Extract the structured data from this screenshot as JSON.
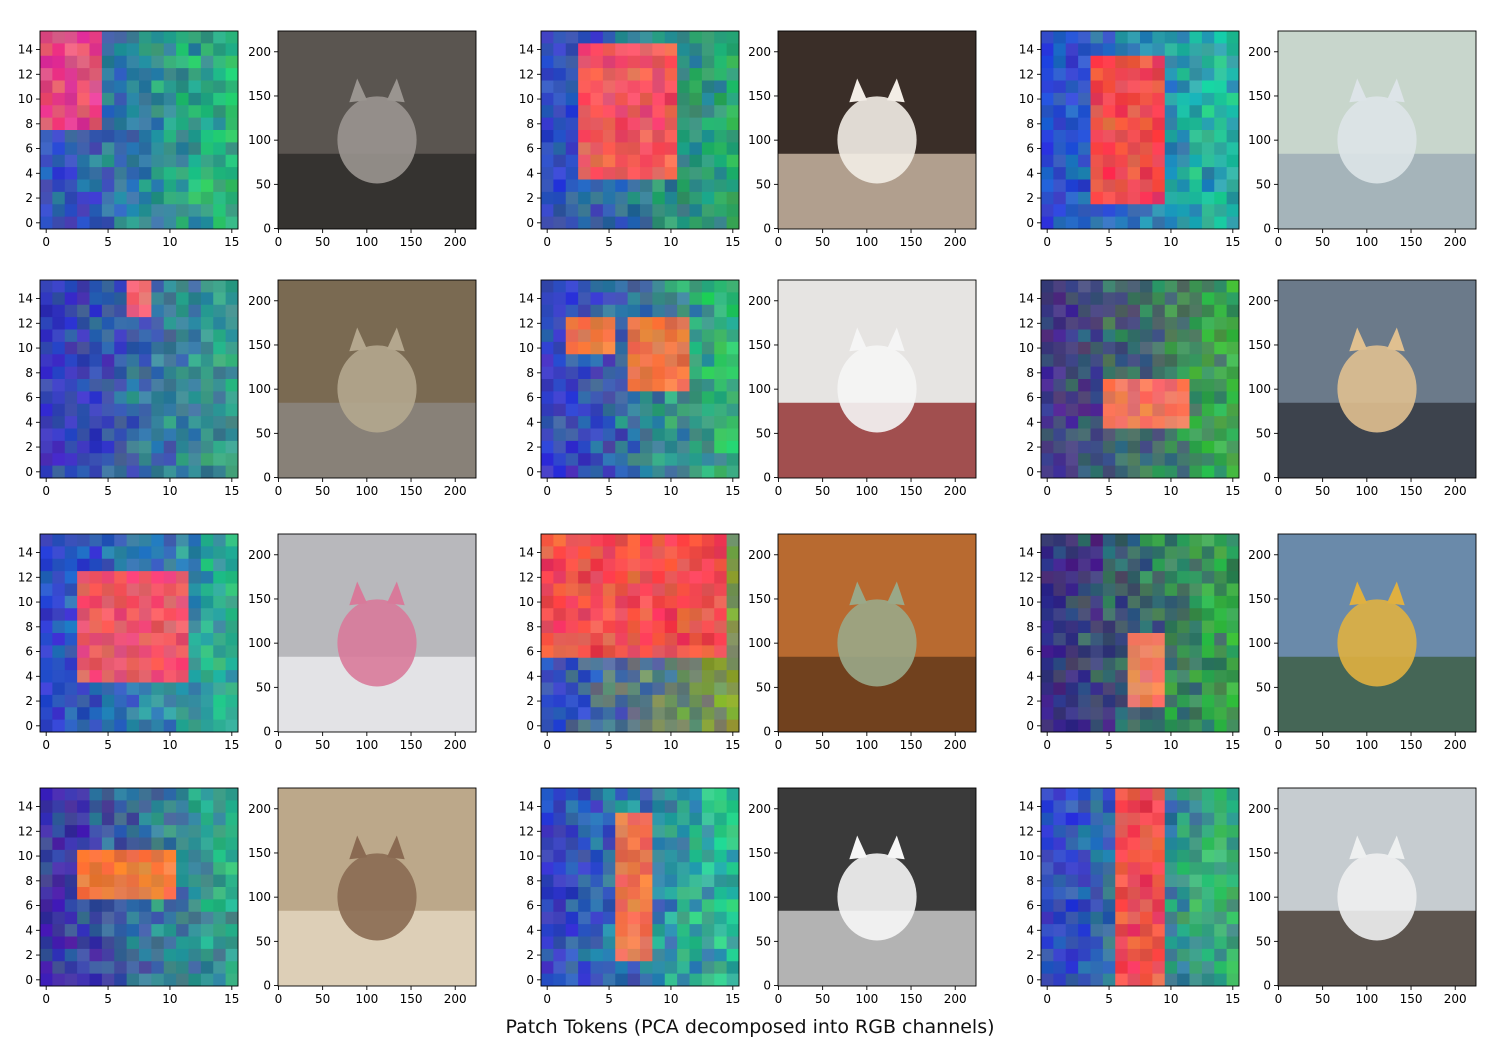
{
  "figure": {
    "caption": "Patch Tokens (PCA decomposed into RGB channels)"
  },
  "chart_data": {
    "type": "heatmap",
    "title": "",
    "xlabel": "",
    "ylabel": "",
    "grid": false,
    "layout": "4 rows x 3 columns of (PCA patch heatmap, source image) pairs",
    "heatmap_axes": {
      "grid_size": 16,
      "x_range": [
        -0.5,
        15.5
      ],
      "y_range": [
        15.5,
        -0.5
      ],
      "x_ticks": [
        0,
        5,
        10,
        15
      ],
      "y_ticks": [
        0,
        2,
        4,
        6,
        8,
        10,
        12,
        14
      ]
    },
    "image_axes": {
      "size": 224,
      "x_range": [
        -0.5,
        223.5
      ],
      "y_range": [
        223.5,
        -0.5
      ],
      "x_ticks": [
        0,
        50,
        100,
        150,
        200
      ],
      "y_ticks": [
        0,
        50,
        100,
        150,
        200
      ]
    },
    "colors": {
      "blue": "#2a3fc8",
      "green": "#2bc86a",
      "teal": "#2fae8e",
      "magenta": "#e0309a",
      "red": "#ee3b55",
      "orange": "#e8803a",
      "purple": "#4c3a9c",
      "olive": "#8a9a3a"
    },
    "panels": [
      {
        "photo": "cat-with-sushi-bag",
        "palette": [
          "#e23596",
          "#28c66f",
          "#3a46c4"
        ],
        "highlight": [
          [
            0,
            0,
            5,
            8
          ]
        ]
      },
      {
        "photo": "kitten-with-bow-tie",
        "palette": [
          "#ef4466",
          "#2bb35f",
          "#3245c8"
        ],
        "highlight": [
          [
            3,
            1,
            11,
            12
          ]
        ]
      },
      {
        "photo": "tabby-kitten-looking-up",
        "palette": [
          "#ee3452",
          "#27c49a",
          "#2b44d0"
        ],
        "highlight": [
          [
            4,
            2,
            10,
            14
          ]
        ]
      },
      {
        "photo": "cat-on-refrigerator",
        "palette": [
          "#ee5a8c",
          "#37a483",
          "#3634c0"
        ],
        "highlight": [
          [
            7,
            0,
            9,
            3
          ]
        ]
      },
      {
        "photo": "cat-with-coffee-bag",
        "palette": [
          "#e8704a",
          "#2ec46a",
          "#3a38c6"
        ],
        "highlight": [
          [
            2,
            3,
            6,
            6
          ],
          [
            7,
            3,
            12,
            9
          ]
        ]
      },
      {
        "photo": "bengal-cat-at-lake",
        "palette": [
          "#ee6a6a",
          "#3ab04a",
          "#44308a"
        ],
        "highlight": [
          [
            5,
            8,
            12,
            12
          ]
        ]
      },
      {
        "photo": "white-cat-with-roses",
        "palette": [
          "#ea407a",
          "#2fb88a",
          "#2f3fcc"
        ],
        "highlight": [
          [
            3,
            3,
            12,
            12
          ]
        ]
      },
      {
        "photo": "bengal-cat-face-closeup",
        "palette": [
          "#ee3a55",
          "#8aa63a",
          "#3050c8"
        ],
        "highlight": [
          [
            0,
            0,
            15,
            10
          ]
        ]
      },
      {
        "photo": "cat-on-mountain-with-hiker",
        "palette": [
          "#ee7a6a",
          "#39b04a",
          "#3a2a86"
        ],
        "highlight": [
          [
            7,
            8,
            10,
            14
          ]
        ]
      },
      {
        "photo": "cat-on-shelf-above-man",
        "palette": [
          "#ee6a40",
          "#2fb88a",
          "#3f2aa8"
        ],
        "highlight": [
          [
            3,
            5,
            11,
            9
          ]
        ]
      },
      {
        "photo": "white-cat-peeking-from-door",
        "palette": [
          "#ee6a5a",
          "#2fc88a",
          "#3340c4"
        ],
        "highlight": [
          [
            6,
            2,
            9,
            14
          ]
        ]
      },
      {
        "photo": "cat-climbing-window",
        "palette": [
          "#ee3a55",
          "#39b86a",
          "#2e40cc"
        ],
        "highlight": [
          [
            6,
            0,
            10,
            16
          ]
        ]
      }
    ]
  }
}
